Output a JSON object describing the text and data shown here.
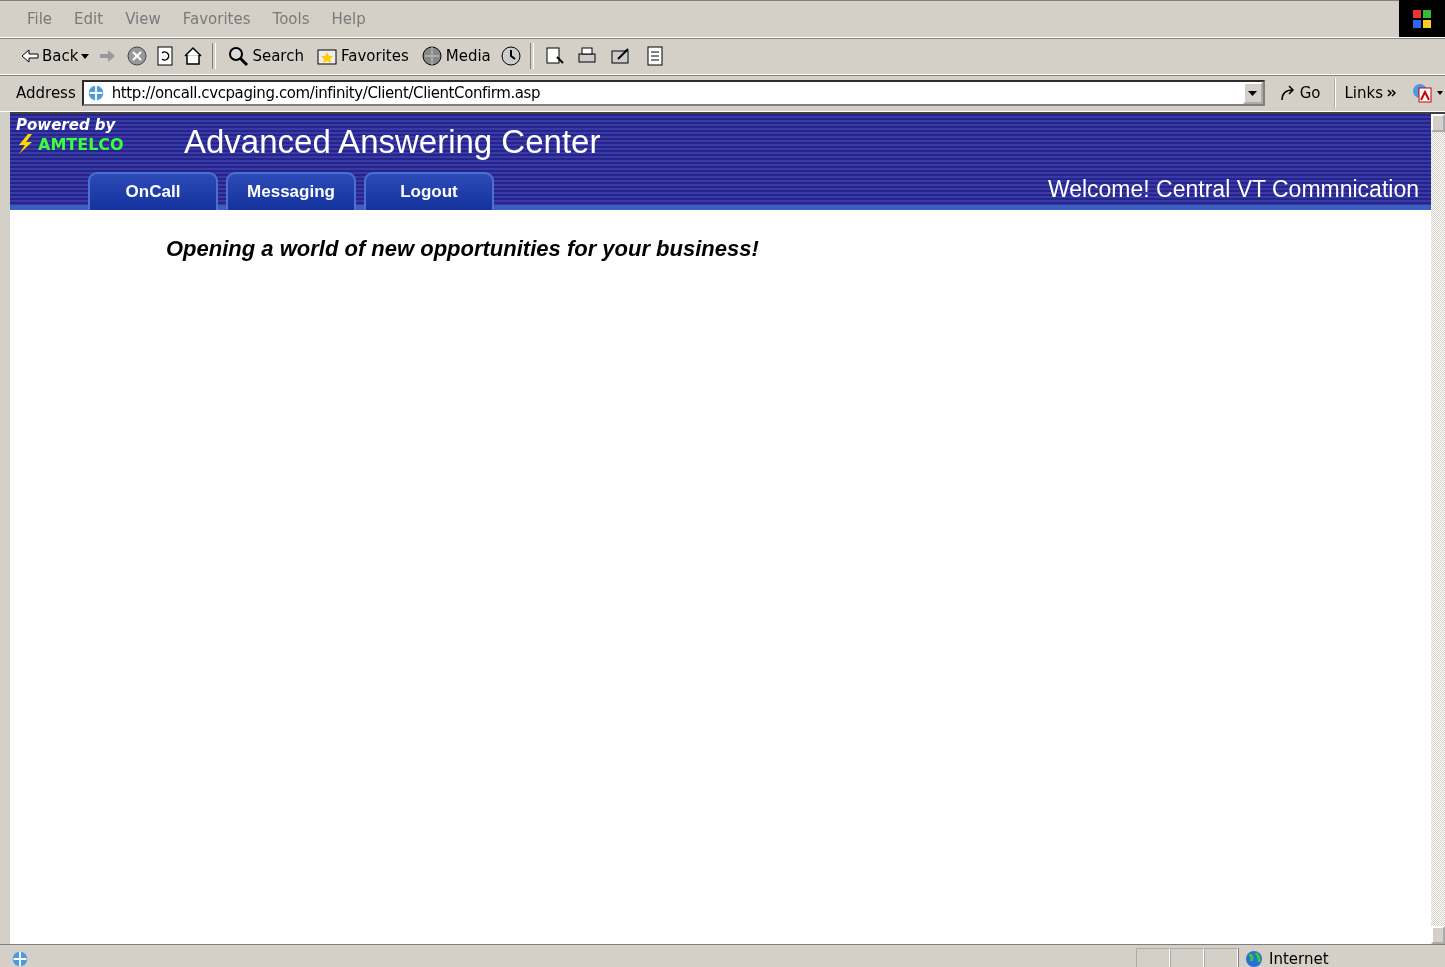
{
  "menu": [
    "File",
    "Edit",
    "View",
    "Favorites",
    "Tools",
    "Help"
  ],
  "toolbar": {
    "back": "Back",
    "search": "Search",
    "favorites": "Favorites",
    "media": "Media"
  },
  "address": {
    "label": "Address",
    "value": "http://oncall.cvcpaging.com/infinity/Client/ClientConfirm.asp",
    "go": "Go",
    "links": "Links"
  },
  "header": {
    "powered_by": "Powered by",
    "brand": "AMTELCO",
    "title": "Advanced Answering Center",
    "welcome": "Welcome! Central VT Commnication"
  },
  "tabs": [
    {
      "label": "OnCall"
    },
    {
      "label": "Messaging"
    },
    {
      "label": "Logout"
    }
  ],
  "tagline": "Opening a world of new opportunities for your business!",
  "status_bar": {
    "zone": "Internet"
  }
}
